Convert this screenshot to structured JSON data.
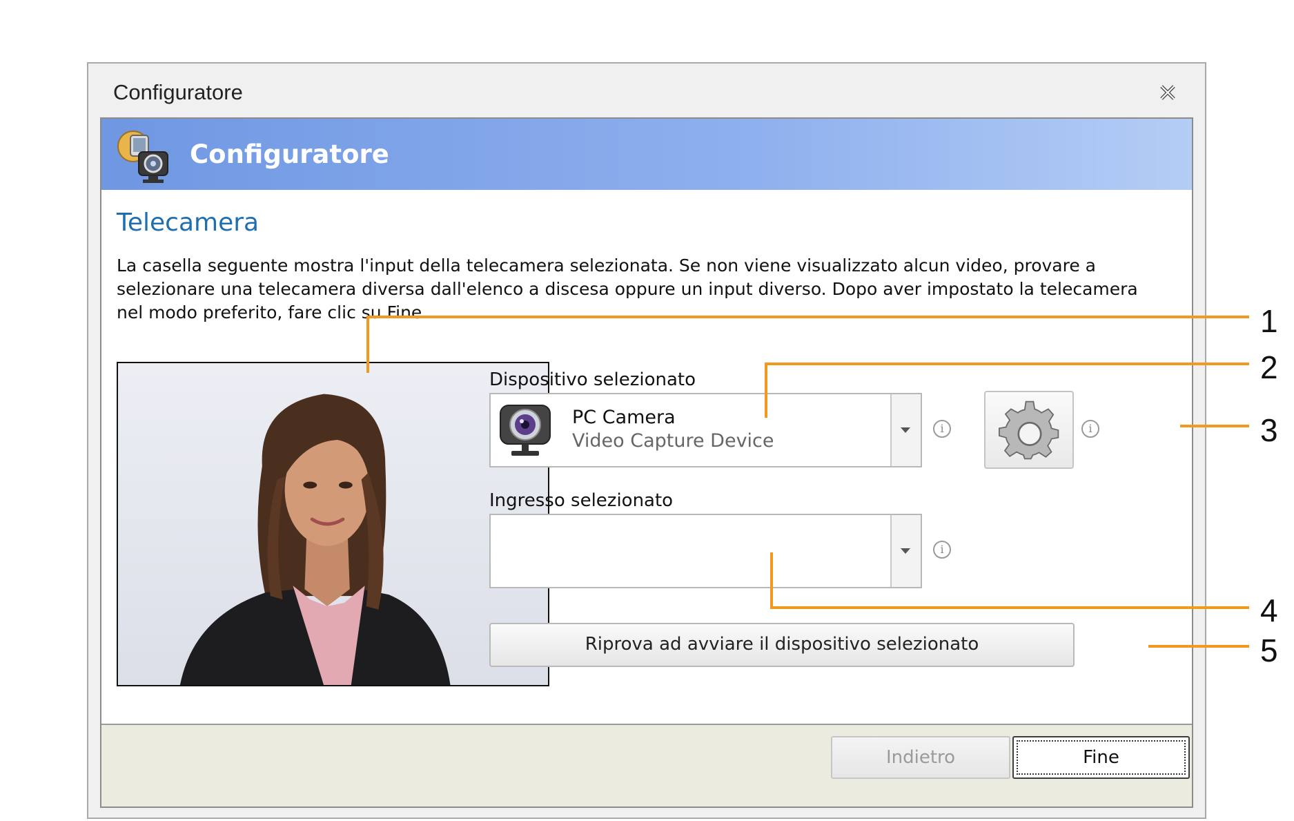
{
  "window": {
    "title": "Configuratore"
  },
  "banner": {
    "title": "Configuratore"
  },
  "section": {
    "title": "Telecamera"
  },
  "description": "La casella seguente mostra l'input della telecamera selezionata. Se non viene visualizzato alcun video, provare a selezionare una telecamera diversa dall'elenco a discesa oppure un input diverso.  Dopo aver impostato la telecamera nel modo preferito, fare clic su Fine.",
  "device": {
    "label": "Dispositivo selezionato",
    "name": "PC Camera",
    "type": "Video Capture Device"
  },
  "input": {
    "label": "Ingresso selezionato",
    "value": ""
  },
  "retry_button": "Riprova ad avviare il dispositivo selezionato",
  "footer": {
    "back": "Indietro",
    "finish": "Fine"
  },
  "callouts": [
    "1",
    "2",
    "3",
    "4",
    "5"
  ],
  "icons": {
    "close": "close-icon",
    "app": "camera-app-icon",
    "device": "webcam-icon",
    "settings": "gear-icon",
    "info": "info-icon",
    "dropdown": "chevron-down-icon"
  },
  "colors": {
    "banner": "#7ba1e6",
    "section_title": "#1f6fb0",
    "callout_line": "#f29a1f",
    "footer": "#ecebe0"
  }
}
